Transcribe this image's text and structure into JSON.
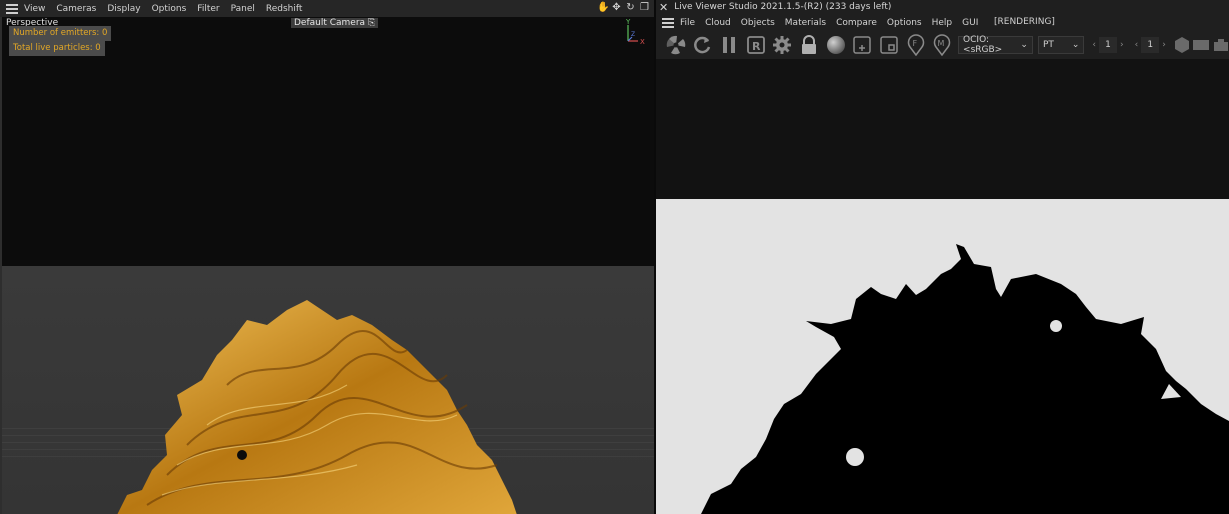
{
  "left": {
    "menu": [
      "View",
      "Cameras",
      "Display",
      "Options",
      "Filter",
      "Panel",
      "Redshift"
    ],
    "viewport_label": "Perspective",
    "camera_label": "Default Camera",
    "camera_icon": "camera-icon",
    "hud": {
      "emitters": "Number of emitters: 0",
      "particles": "Total live particles: 0"
    },
    "axis": {
      "y": "Y",
      "x": "X",
      "z": "Z"
    },
    "nav_icons": [
      "pan-hand-icon",
      "move-arrows-icon",
      "rotate-icon",
      "maximize-icon"
    ],
    "colors": {
      "hud_text": "#e3a826",
      "hud_bg": "#4b4b4b",
      "object_gold": "#c98a1c"
    }
  },
  "right": {
    "close_glyph": "✕",
    "title": "Live Viewer Studio 2021.1.5-(R2) (233 days left)",
    "menu": [
      "File",
      "Cloud",
      "Objects",
      "Materials",
      "Compare",
      "Options",
      "Help",
      "GUI"
    ],
    "status": "[RENDERING]",
    "toolbar_icons": [
      "octane-fan-icon",
      "restart-icon",
      "pause-icon",
      "r-region-icon",
      "settings-gear-icon",
      "lock-icon",
      "sphere-material-icon",
      "add-region-icon",
      "pick-focus-icon",
      "f-pin-icon",
      "m-pin-icon"
    ],
    "ocio": {
      "value": "OCIO:<sRGB>"
    },
    "kernel": {
      "value": "PT"
    },
    "stepper_a": {
      "left": "‹",
      "value": "1",
      "right": "›"
    },
    "stepper_b": {
      "left": "‹",
      "value": "1",
      "right": "›"
    },
    "trailing_icons": [
      "hexagon-icon",
      "film-icon",
      "camera-icon"
    ],
    "colors": {
      "render_bg": "#e3e3e3",
      "silhouette": "#000000"
    }
  }
}
